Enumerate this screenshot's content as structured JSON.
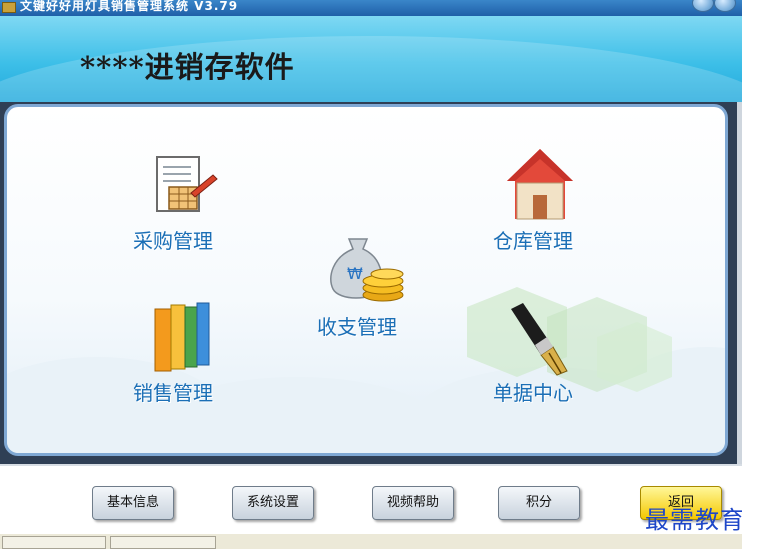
{
  "window": {
    "title": "文键好好用灯具销售管理系统 V3.79"
  },
  "header": {
    "app_title": "****进销存软件"
  },
  "modules": [
    {
      "id": "purchase",
      "label": "采购管理",
      "icon": "document-edit-icon"
    },
    {
      "id": "warehouse",
      "label": "仓库管理",
      "icon": "house-icon"
    },
    {
      "id": "finance",
      "label": "收支管理",
      "icon": "money-bag-icon"
    },
    {
      "id": "sales",
      "label": "销售管理",
      "icon": "books-icon"
    },
    {
      "id": "documents",
      "label": "单据中心",
      "icon": "fountain-pen-icon"
    }
  ],
  "toolbar": {
    "basic_info": "基本信息",
    "system_settings": "系统设置",
    "video_help": "视频帮助",
    "points": "积分",
    "back": "返回"
  },
  "watermark": "最需教育",
  "colors": {
    "banner": "#3dbfe8",
    "module_label": "#1b6fb6",
    "back_button": "#f5c800"
  }
}
